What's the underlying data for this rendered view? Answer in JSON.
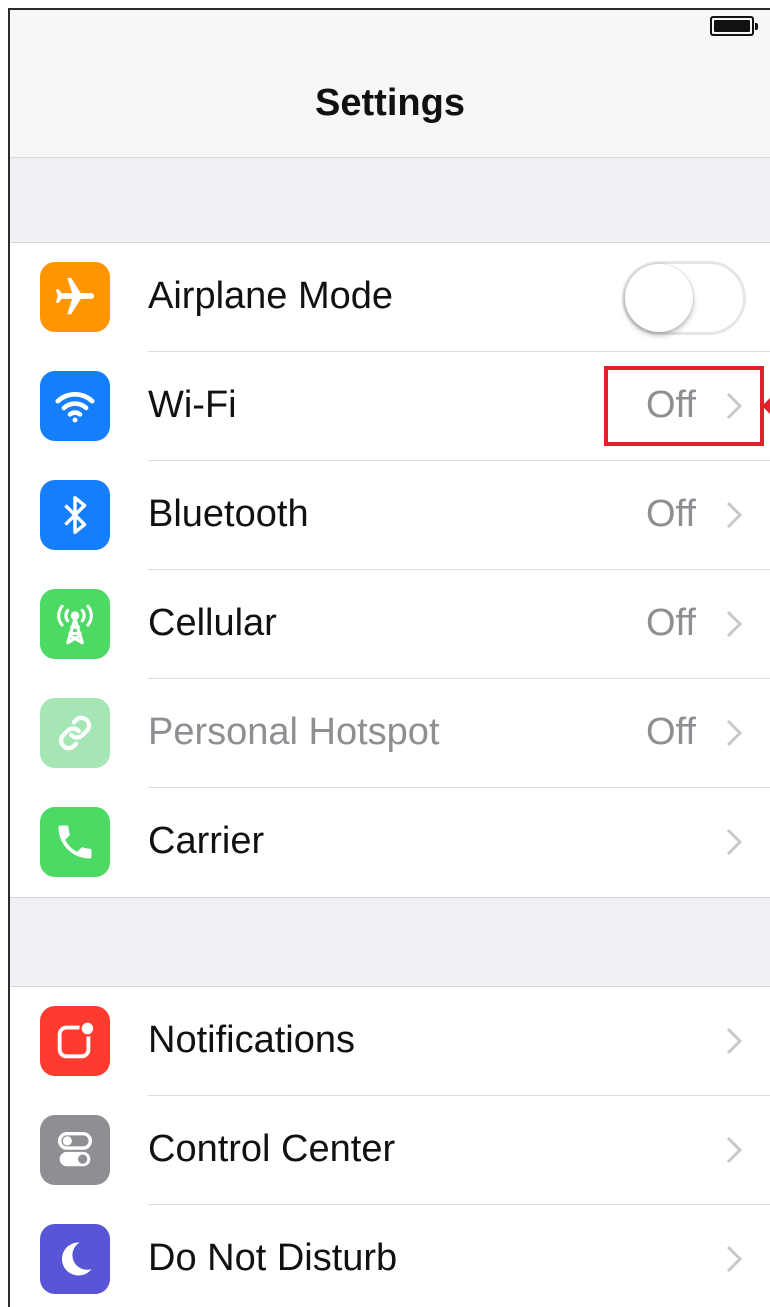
{
  "nav": {
    "title": "Settings"
  },
  "groups": [
    {
      "rows": [
        {
          "label": "Airplane Mode",
          "icon": "airplane-icon",
          "icon_color": "#ff9500",
          "control": "toggle",
          "toggle_on": false
        },
        {
          "label": "Wi-Fi",
          "icon": "wifi-icon",
          "icon_color": "#147efb",
          "value": "Off"
        },
        {
          "label": "Bluetooth",
          "icon": "bluetooth-icon",
          "icon_color": "#147efb",
          "value": "Off"
        },
        {
          "label": "Cellular",
          "icon": "cellular-antenna-icon",
          "icon_color": "#4cd964",
          "value": "Off"
        },
        {
          "label": "Personal Hotspot",
          "icon": "hotspot-link-icon",
          "icon_color": "#a6e6b5",
          "value": "Off",
          "disabled": true
        },
        {
          "label": "Carrier",
          "icon": "phone-icon",
          "icon_color": "#4cd964"
        }
      ]
    },
    {
      "rows": [
        {
          "label": "Notifications",
          "icon": "notifications-icon",
          "icon_color": "#ff3b30"
        },
        {
          "label": "Control Center",
          "icon": "switches-icon",
          "icon_color": "#8e8e93"
        },
        {
          "label": "Do Not Disturb",
          "icon": "moon-icon",
          "icon_color": "#5856d6"
        }
      ]
    }
  ],
  "annotation": {
    "color": "#e0202a"
  }
}
